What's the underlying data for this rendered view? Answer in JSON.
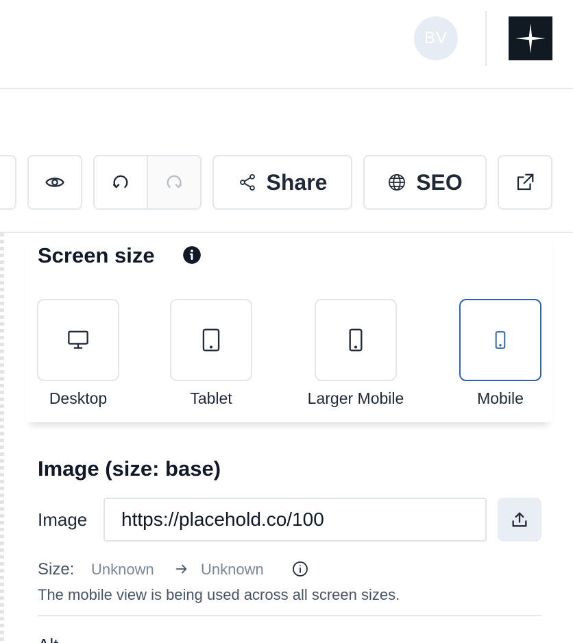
{
  "header": {
    "avatar_initials": "BV",
    "logo_icon": "sparkle-star-icon"
  },
  "toolbar": {
    "preview_icon": "eye-icon",
    "undo_icon": "undo-icon",
    "redo_icon": "redo-icon",
    "share_label": "Share",
    "seo_label": "SEO",
    "open_external_icon": "external-link-icon"
  },
  "screen_size": {
    "title": "Screen size",
    "options": [
      {
        "label": "Desktop",
        "icon": "desktop-icon",
        "selected": false
      },
      {
        "label": "Tablet",
        "icon": "tablet-icon",
        "selected": false
      },
      {
        "label": "Larger Mobile",
        "icon": "large-mobile-icon",
        "selected": false
      },
      {
        "label": "Mobile",
        "icon": "mobile-icon",
        "selected": true
      }
    ]
  },
  "image_section": {
    "title": "Image (size: base)",
    "image_label": "Image",
    "image_value": "https://placehold.co/100",
    "size_label": "Size:",
    "size_from": "Unknown",
    "size_to": "Unknown",
    "note": "The mobile view is being used across all screen sizes.",
    "alt_label": "Alt"
  },
  "colors": {
    "accent": "#2e63b6",
    "border": "#e3e6ea",
    "logo_bg": "#111a22",
    "muted_text": "#7a8699"
  }
}
